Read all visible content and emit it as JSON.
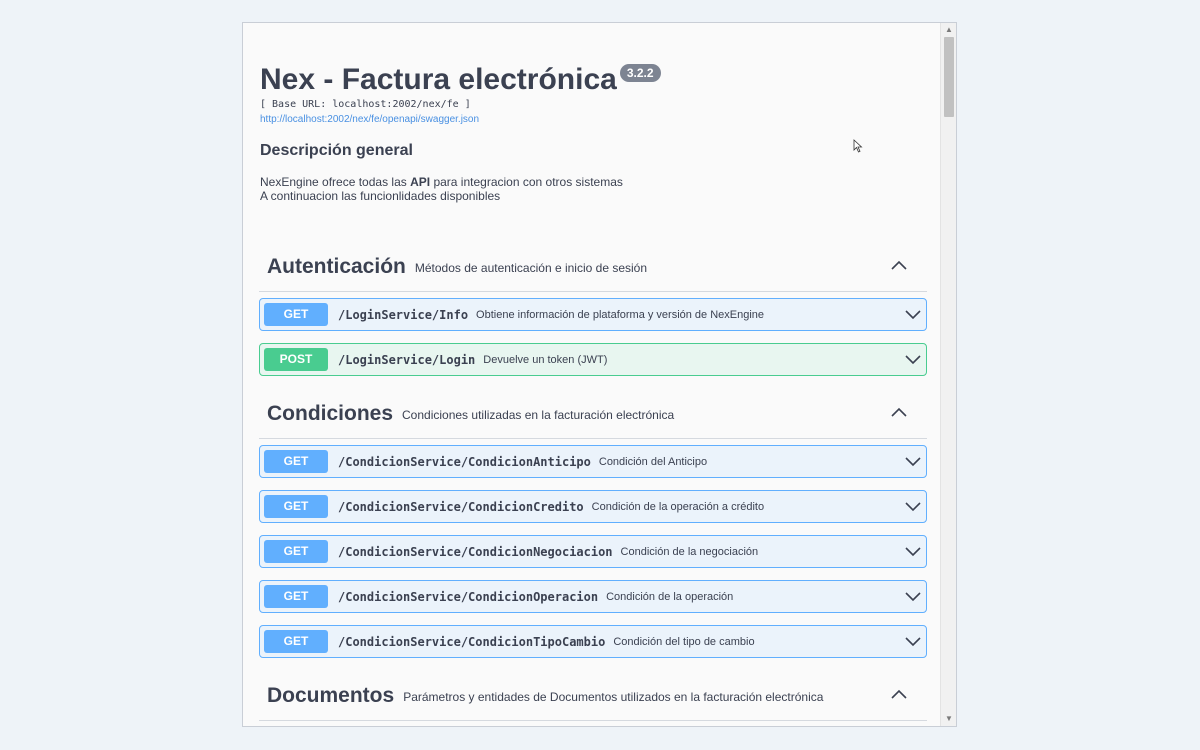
{
  "info": {
    "title": "Nex - Factura electrónica",
    "version": "3.2.2",
    "base_url": "[ Base URL: localhost:2002/nex/fe ]",
    "spec_url": "http://localhost:2002/nex/fe/openapi/swagger.json",
    "desc_heading": "Descripción general",
    "desc_line1_pre": "NexEngine ofrece todas las ",
    "desc_line1_bold": "API",
    "desc_line1_post": " para integracion con otros sistemas",
    "desc_line2": "A continuacion las funcionlidades disponibles"
  },
  "sections": [
    {
      "name": "Autenticación",
      "description": "Métodos de autenticación e inicio de sesión",
      "operations": [
        {
          "method": "GET",
          "path": "/LoginService/Info",
          "summary": "Obtiene información de plataforma y versión de NexEngine"
        },
        {
          "method": "POST",
          "path": "/LoginService/Login",
          "summary": "Devuelve un token (JWT)"
        }
      ]
    },
    {
      "name": "Condiciones",
      "description": "Condiciones utilizadas en la facturación electrónica",
      "operations": [
        {
          "method": "GET",
          "path": "/CondicionService/CondicionAnticipo",
          "summary": "Condición del Anticipo"
        },
        {
          "method": "GET",
          "path": "/CondicionService/CondicionCredito",
          "summary": "Condición de la operación a crédito"
        },
        {
          "method": "GET",
          "path": "/CondicionService/CondicionNegociacion",
          "summary": "Condición de la negociación"
        },
        {
          "method": "GET",
          "path": "/CondicionService/CondicionOperacion",
          "summary": "Condición de la operación"
        },
        {
          "method": "GET",
          "path": "/CondicionService/CondicionTipoCambio",
          "summary": "Condición del tipo de cambio"
        }
      ]
    },
    {
      "name": "Documentos",
      "description": "Parámetros y entidades de Documentos utilizados en la facturación electrónica",
      "operations": []
    }
  ],
  "colors": {
    "get": "#61affe",
    "post": "#49cc90",
    "text": "#3b4151",
    "link": "#4990e2"
  },
  "icons": {
    "collapse": "chevron-up-icon",
    "expand": "chevron-down-icon",
    "cursor": "mouse-pointer-icon"
  }
}
